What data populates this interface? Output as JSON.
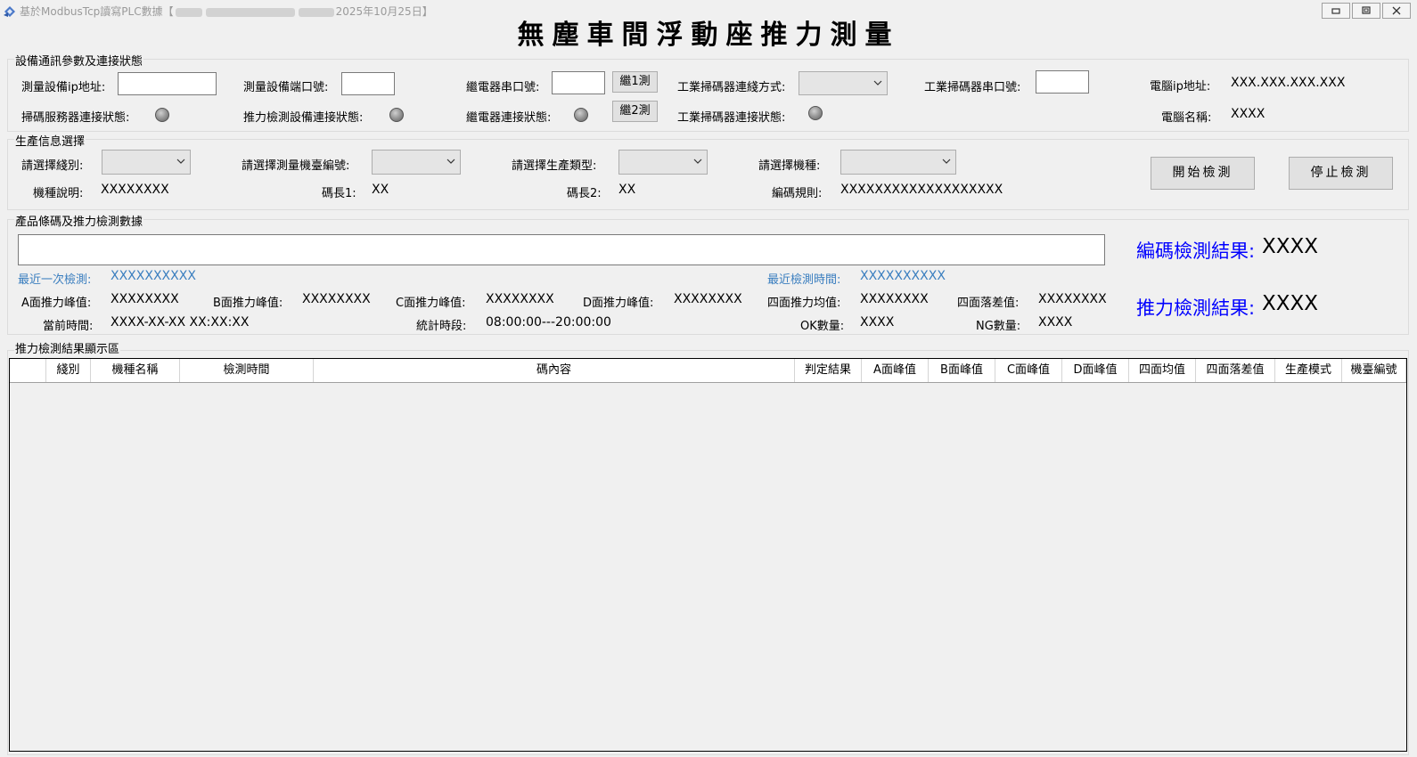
{
  "window": {
    "title_prefix": "基於ModbusTcp讀寫PLC數據【",
    "title_date": "2025年10月25日】"
  },
  "page_title": "無塵車間浮動座推力測量",
  "device": {
    "group_title": "設備通訊參數及連接狀態",
    "ip_label": "測量設備ip地址:",
    "ip_value": "",
    "port_label": "測量設備端口號:",
    "port_value": "",
    "relay_port_label": "繼電器串口號:",
    "relay_port_value": "",
    "relay1_button": "繼1測",
    "relay2_button": "繼2測",
    "scanner_conn_mode_label": "工業掃碼器連綫方式:",
    "scanner_conn_mode_value": "",
    "scanner_port_label": "工業掃碼器串口號:",
    "scanner_port_value": "",
    "pc_ip_label": "電腦ip地址:",
    "pc_ip_value": "XXX.XXX.XXX.XXX",
    "scan_server_status_label": "掃碼服務器連接狀態:",
    "thrust_device_status_label": "推力檢測設備連接狀態:",
    "relay_status_label": "繼電器連接狀態:",
    "scanner_status_label": "工業掃碼器連接狀態:",
    "pc_name_label": "電腦名稱:",
    "pc_name_value": "XXXX"
  },
  "production": {
    "group_title": "生產信息選擇",
    "line_label": "請選擇綫別:",
    "machine_no_label": "請選擇測量機臺編號:",
    "prod_type_label": "請選擇生產類型:",
    "model_label": "請選擇機種:",
    "model_desc_label": "機種說明:",
    "model_desc_value": "XXXXXXXX",
    "code_len1_label": "碼長1:",
    "code_len1_value": "XX",
    "code_len2_label": "碼長2:",
    "code_len2_value": "XX",
    "code_rule_label": "編碼規則:",
    "code_rule_value": "XXXXXXXXXXXXXXXXXXX",
    "start_button": "開始檢測",
    "stop_button": "停止檢測"
  },
  "detection": {
    "group_title": "產品條碼及推力檢測數據",
    "barcode_value": "",
    "last_check_label": "最近一次檢測:",
    "last_check_value": "XXXXXXXXXX",
    "last_check_time_label": "最近檢測時間:",
    "last_check_time_value": "XXXXXXXXXX",
    "a_peak_label": "A面推力峰值:",
    "a_peak_value": "XXXXXXXX",
    "b_peak_label": "B面推力峰值:",
    "b_peak_value": "XXXXXXXX",
    "c_peak_label": "C面推力峰值:",
    "c_peak_value": "XXXXXXXX",
    "d_peak_label": "D面推力峰值:",
    "d_peak_value": "XXXXXXXX",
    "avg_label": "四面推力均值:",
    "avg_value": "XXXXXXXX",
    "diff_label": "四面落差值:",
    "diff_value": "XXXXXXXX",
    "current_time_label": "當前時間:",
    "current_time_value": "XXXX-XX-XX XX:XX:XX",
    "stat_period_label": "統計時段:",
    "stat_period_value": "08:00:00---20:00:00",
    "ok_label": "OK數量:",
    "ok_value": "XXXX",
    "ng_label": "NG數量:",
    "ng_value": "XXXX",
    "code_result_label": "編碼檢測結果:",
    "code_result_value": "XXXX",
    "thrust_result_label": "推力檢測結果:",
    "thrust_result_value": "XXXX"
  },
  "results": {
    "group_title": "推力檢測結果顯示區",
    "columns": [
      "綫別",
      "機種名稱",
      "檢測時間",
      "碼內容",
      "判定結果",
      "A面峰值",
      "B面峰值",
      "C面峰值",
      "D面峰值",
      "四面均值",
      "四面落差值",
      "生產模式",
      "機臺編號"
    ]
  }
}
